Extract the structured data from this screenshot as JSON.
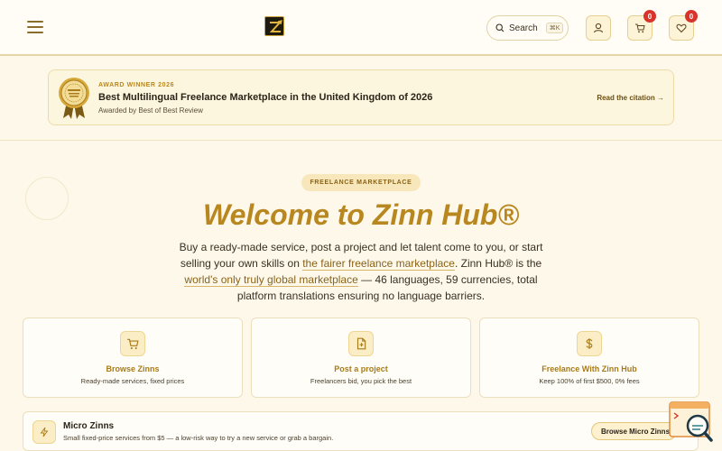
{
  "header": {
    "search_label": "Search",
    "search_shortcut": "⌘K",
    "cart_count": "0",
    "wishlist_count": "0"
  },
  "award": {
    "kicker": "AWARD WINNER 2026",
    "title": "Best Multilingual Freelance Marketplace in the United Kingdom of 2026",
    "subtitle": "Awarded by Best of Best Review",
    "link_label": "Read the citation →"
  },
  "hero": {
    "pill": "FREELANCE MARKETPLACE",
    "title": "Welcome to Zinn Hub®",
    "text_1": "Buy a ready-made service, post a project and let talent come to you, or start selling your own skills on ",
    "link_1": "the fairer freelance marketplace",
    "text_2": ". Zinn Hub® is the ",
    "link_2": "world's only truly global marketplace",
    "text_3": " — 46 languages, 59 currencies, total platform translations ensuring no language barriers."
  },
  "cards": [
    {
      "title": "Browse Zinns",
      "subtitle": "Ready-made services, fixed prices",
      "icon": "cart-icon"
    },
    {
      "title": "Post a project",
      "subtitle": "Freelancers bid, you pick the best",
      "icon": "document-icon"
    },
    {
      "title": "Freelance With Zinn Hub",
      "subtitle": "Keep 100% of first $500, 0% fees",
      "icon": "dollar-icon"
    }
  ],
  "micro": {
    "title": "Micro Zinns",
    "subtitle": "Small fixed-price services from $5 — a low-risk way to try a new service or grab a bargain.",
    "button_label": "Browse Micro Zinns",
    "icon": "lightning-icon"
  },
  "colors": {
    "accent": "#b8871f",
    "background": "#fdf8ea",
    "badge": "#d9342b"
  }
}
